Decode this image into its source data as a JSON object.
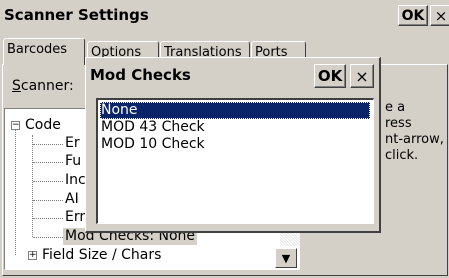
{
  "window": {
    "title": "Scanner Settings",
    "ok_label": "OK",
    "close_label": "×"
  },
  "tabs": [
    {
      "label": "Barcodes",
      "active": true
    },
    {
      "label": "Options",
      "active": false
    },
    {
      "label": "Translations",
      "active": false
    },
    {
      "label": "Ports",
      "active": false
    }
  ],
  "scanner_label": {
    "mnemonic": "S",
    "rest": "canner:"
  },
  "help_text": [
    "e a",
    "ress",
    "nt-arrow,",
    "click."
  ],
  "tree": {
    "root_expander": "−",
    "root_label": "Code",
    "children": [
      "Er",
      "Fu",
      "Inc",
      "AI",
      "Err",
      "Mod Checks: None"
    ],
    "sibling_expander": "+",
    "sibling_label": "Field Size / Chars",
    "combo_arrow": "▼"
  },
  "dialog": {
    "title": "Mod Checks",
    "ok_label": "OK",
    "close_label": "×",
    "items": [
      {
        "label": "None",
        "selected": true
      },
      {
        "label": "MOD 43 Check",
        "selected": false
      },
      {
        "label": "MOD 10 Check",
        "selected": false
      }
    ]
  },
  "colors": {
    "face": "#d4d0c8",
    "selection": "#0a246a",
    "selection_text": "#ffffff"
  }
}
